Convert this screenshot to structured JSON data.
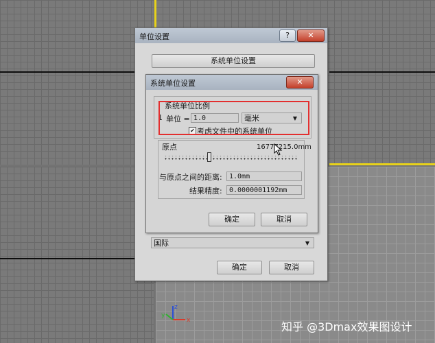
{
  "outer_dialog": {
    "title": "单位设置",
    "help": "?",
    "close": "✕",
    "system_button": "系统单位设置",
    "display_dropdown": "国际",
    "ok": "确定",
    "cancel": "取消"
  },
  "inner_dialog": {
    "title": "系统单位设置",
    "close": "✕",
    "scale_group_label": "系统单位比例",
    "unit_prefix": "1",
    "unit_label": "单位 =",
    "unit_value": "1.0",
    "unit_dropdown": "毫米",
    "respect_checkbox_label": "考虑文件中的系统单位",
    "respect_checked": true,
    "origin_label": "原点",
    "origin_value": "16777215.0mm",
    "distance_label": "与原点之间的距离:",
    "distance_value": "1.0mm",
    "precision_label": "结果精度:",
    "precision_value": "0.0000001192mm",
    "ok": "确定",
    "cancel": "取消"
  },
  "gizmo": {
    "x": "x",
    "y": "y",
    "z": "z"
  },
  "watermark": "知乎 @3Dmax效果图设计",
  "colors": {
    "highlight": "#e32f2f",
    "active_viewport": "#e8d21a"
  }
}
